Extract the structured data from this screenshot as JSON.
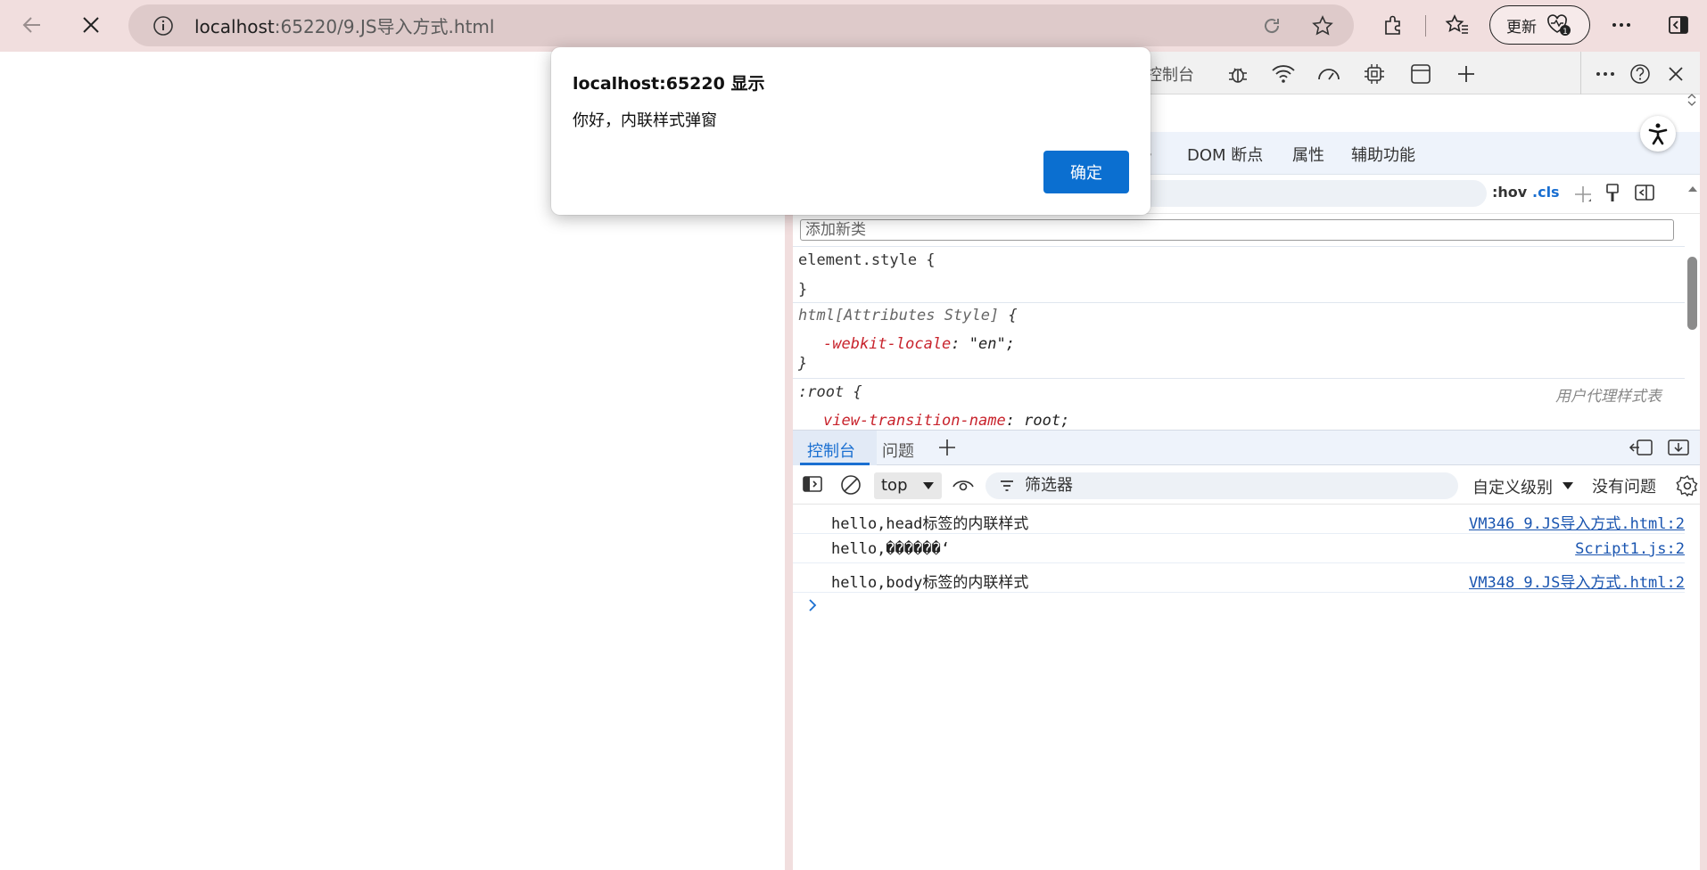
{
  "browser": {
    "url_host": "localhost",
    "url_path": ":65220/9.JS导入方式.html",
    "update_label": "更新",
    "update_badge": "1"
  },
  "devtools": {
    "top_tab_console": "控制台",
    "subtabs": {
      "partial": "s",
      "dom_breakpoints": "DOM 断点",
      "properties": "属性",
      "accessibility": "辅助功能"
    },
    "styles": {
      "hov": ":hov",
      "cls": ".cls",
      "add_class_placeholder": "添加新类",
      "element_style_open": "element.style {",
      "close_brace": "}",
      "html_selector": "html[Attributes Style]",
      "open_brace": " {",
      "webkit_locale_prop": "-webkit-locale",
      "webkit_locale_value": ": \"en\";",
      "root_selector": ":root {",
      "user_agent_label": "用户代理样式表",
      "view_transition_prop": "view-transition-name",
      "view_transition_value": ": root;"
    },
    "drawer": {
      "tab_console": "控制台",
      "tab_issues": "问题"
    },
    "console": {
      "context": "top",
      "filter_placeholder": "筛选器",
      "levels": "自定义级别",
      "no_issues": "没有问题",
      "messages": [
        {
          "text": "hello,head标签的内联样式",
          "source": "VM346 9.JS导入方式.html:2"
        },
        {
          "text": "hello,������‘",
          "source": "Script1.js:2"
        },
        {
          "text": "hello,body标签的内联样式",
          "source": "VM348 9.JS导入方式.html:2"
        }
      ]
    }
  },
  "dialog": {
    "title": "localhost:65220 显示",
    "message": "你好，内联样式弹窗",
    "ok_label": "确定"
  },
  "colors": {
    "accent": "#0b6fd0",
    "frame": "#f1dede",
    "css_property": "#c8232c"
  }
}
